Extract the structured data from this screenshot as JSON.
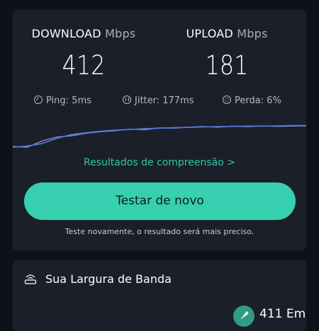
{
  "download": {
    "label": "DOWNLOAD",
    "unit": "Mbps",
    "value": "412"
  },
  "upload": {
    "label": "UPLOAD",
    "unit": "Mbps",
    "value": "181"
  },
  "stats": {
    "ping": "Ping: 5ms",
    "jitter": "Jitter: 177ms",
    "loss": "Perda: 6%"
  },
  "graph": {
    "download_color": "#4f7fdc",
    "upload_color": "#8a7fd1",
    "download_points": [
      0.05,
      0.1,
      0.2,
      0.4,
      0.55,
      0.62,
      0.68,
      0.72,
      0.75,
      0.78,
      0.8,
      0.82,
      0.83,
      0.85,
      0.86,
      0.87,
      0.88,
      0.88,
      0.89,
      0.9,
      0.9
    ],
    "upload_points": [
      0.08,
      0.05,
      0.3,
      0.45,
      0.5,
      0.6,
      0.66,
      0.7,
      0.76,
      0.74,
      0.81,
      0.8,
      0.84,
      0.86,
      0.84,
      0.88,
      0.86,
      0.89,
      0.87,
      0.88,
      0.89
    ]
  },
  "links": {
    "results": "Resultados de compreensão >"
  },
  "actions": {
    "retest": "Testar de novo"
  },
  "hint": "Teste novamente, o resultado será mais preciso.",
  "bandwidth": {
    "title": "Sua Largura de Banda",
    "value": "411 Em"
  },
  "colors": {
    "accent": "#36d0b0",
    "link": "#2dc9a8",
    "card": "#1b1f29",
    "background": "#0e1119"
  }
}
